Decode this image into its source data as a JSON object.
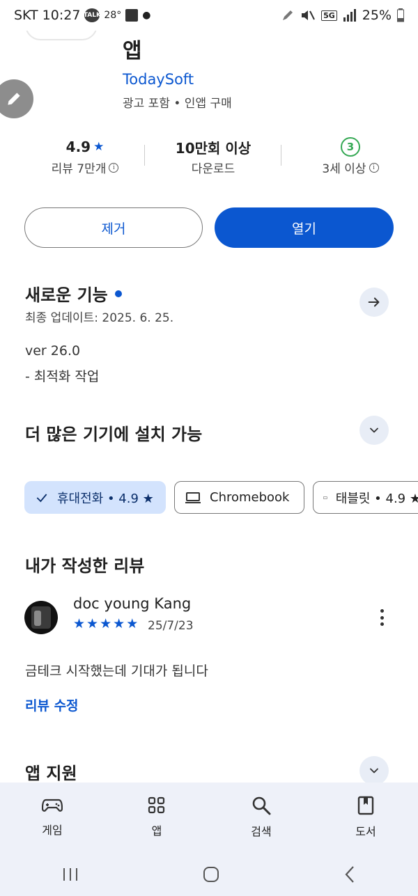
{
  "status_bar": {
    "carrier": "SKT",
    "time": "10:27",
    "talk_badge": "TALK",
    "temperature": "28°",
    "network": "5G",
    "battery": "25%"
  },
  "app": {
    "title_line2": "앱",
    "developer": "TodaySoft",
    "subinfo": "광고 포함 • 인앱 구매"
  },
  "stats": {
    "rating_value": "4.9",
    "rating_label": "리뷰 7만개",
    "downloads_value": "10만회 이상",
    "downloads_label": "다운로드",
    "age_badge": "3",
    "age_label": "3세 이상"
  },
  "buttons": {
    "remove": "제거",
    "open": "열기"
  },
  "whats_new": {
    "title": "새로운 기능",
    "updated": "최종 업데이트: 2025. 6. 25.",
    "version": "ver 26.0",
    "note": "- 최적화 작업"
  },
  "devices": {
    "title": "더 많은 기기에 설치 가능",
    "chips": [
      {
        "label": "휴대전화 • 4.9 ★",
        "selected": true
      },
      {
        "label": "Chromebook",
        "selected": false
      },
      {
        "label": "태블릿 • 4.9 ★",
        "selected": false
      }
    ]
  },
  "my_review": {
    "title": "내가 작성한 리뷰",
    "reviewer": "doc young Kang",
    "stars": 5,
    "date": "25/7/23",
    "text": "금테크 시작했는데 기대가 됩니다",
    "edit_link": "리뷰 수정"
  },
  "app_support": {
    "title": "앱 지원"
  },
  "bottom_nav": [
    {
      "label": "게임",
      "icon": "gamepad-icon"
    },
    {
      "label": "앱",
      "icon": "apps-grid-icon"
    },
    {
      "label": "검색",
      "icon": "search-icon"
    },
    {
      "label": "도서",
      "icon": "book-icon"
    }
  ],
  "colors": {
    "accent": "#0b57d0",
    "chip_selected": "#d3e3fd",
    "age_green": "#34a853",
    "nav_bg": "#eef1f9"
  }
}
